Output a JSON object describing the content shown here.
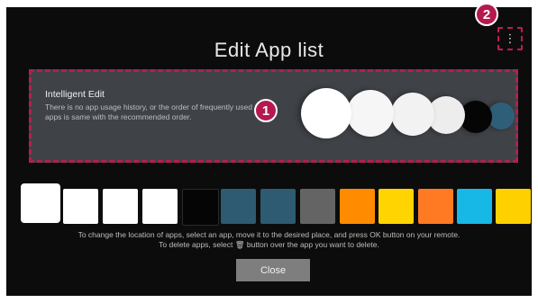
{
  "header": {
    "title": "Edit App list",
    "more_label": "⋮"
  },
  "callouts": {
    "one": "1",
    "two": "2"
  },
  "intelligent_edit": {
    "title": "Intelligent Edit",
    "description_line1": "There is no app usage history, or the order of frequently used",
    "description_line2": "apps is same with the recommended order."
  },
  "recommended_apps": [
    {
      "color": "#ffffff"
    },
    {
      "color": "#f6f6f6"
    },
    {
      "color": "#f2f2f2"
    },
    {
      "color": "#ededed"
    },
    {
      "color": "#050505"
    },
    {
      "color": "#2f5f78"
    }
  ],
  "app_tiles": [
    {
      "color": "#ffffff"
    },
    {
      "color": "#ffffff"
    },
    {
      "color": "#ffffff"
    },
    {
      "color": "#ffffff"
    },
    {
      "color": "#050505"
    },
    {
      "color": "#2e5a72"
    },
    {
      "color": "#2e5a72"
    },
    {
      "color": "#646464"
    },
    {
      "color": "#ff8c00"
    },
    {
      "color": "#ffd400"
    },
    {
      "color": "#ff7a22"
    },
    {
      "color": "#17b8e6"
    },
    {
      "color": "#ffd000"
    },
    {
      "color": "#ee1c25"
    }
  ],
  "instructions": {
    "line1": "To change the location of apps, select an app, move it to the desired place, and press OK button on your remote.",
    "line2": "To delete apps, select 🗑 button over the app you want to delete."
  },
  "close_label": "Close",
  "colors": {
    "screen_bg": "#0c0c0c",
    "panel_bg": "#3f4247",
    "highlight": "#b0204f"
  }
}
